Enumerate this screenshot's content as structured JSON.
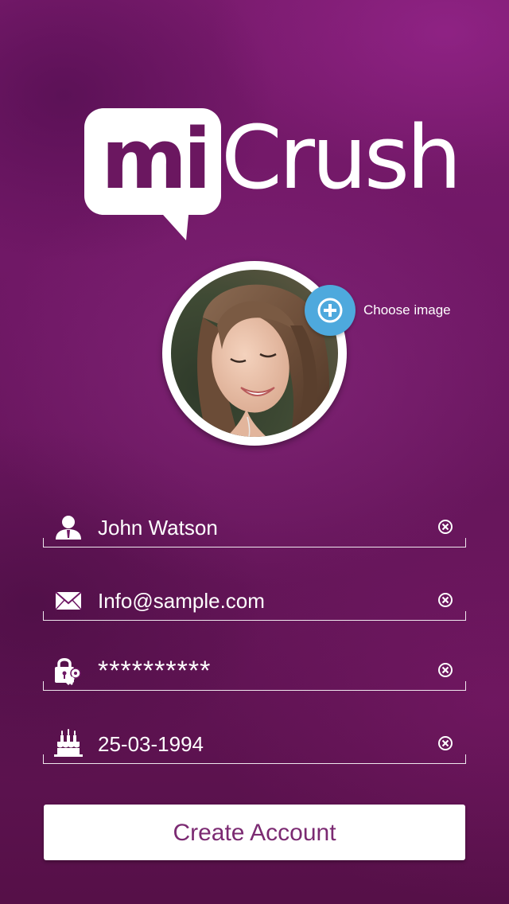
{
  "app": {
    "logo_mi": "mi",
    "logo_crush": "Crush"
  },
  "profile": {
    "choose_image_label": "Choose image",
    "add_icon": "plus-circle-icon"
  },
  "form": {
    "fields": [
      {
        "name": "name",
        "value": "John Watson",
        "icon": "user-icon"
      },
      {
        "name": "email",
        "value": "Info@sample.com",
        "icon": "envelope-icon"
      },
      {
        "name": "password",
        "value": "**********",
        "icon": "lock-key-icon"
      },
      {
        "name": "birthday",
        "value": "25-03-1994",
        "icon": "birthday-cake-icon"
      }
    ],
    "clear_icon": "clear-circle-x-icon"
  },
  "actions": {
    "create_account_label": "Create Account"
  },
  "colors": {
    "background": "#6e1764",
    "accent_blue": "#4ea9dd",
    "logo_purple": "#6b1760",
    "button_text": "#7b2a72"
  }
}
